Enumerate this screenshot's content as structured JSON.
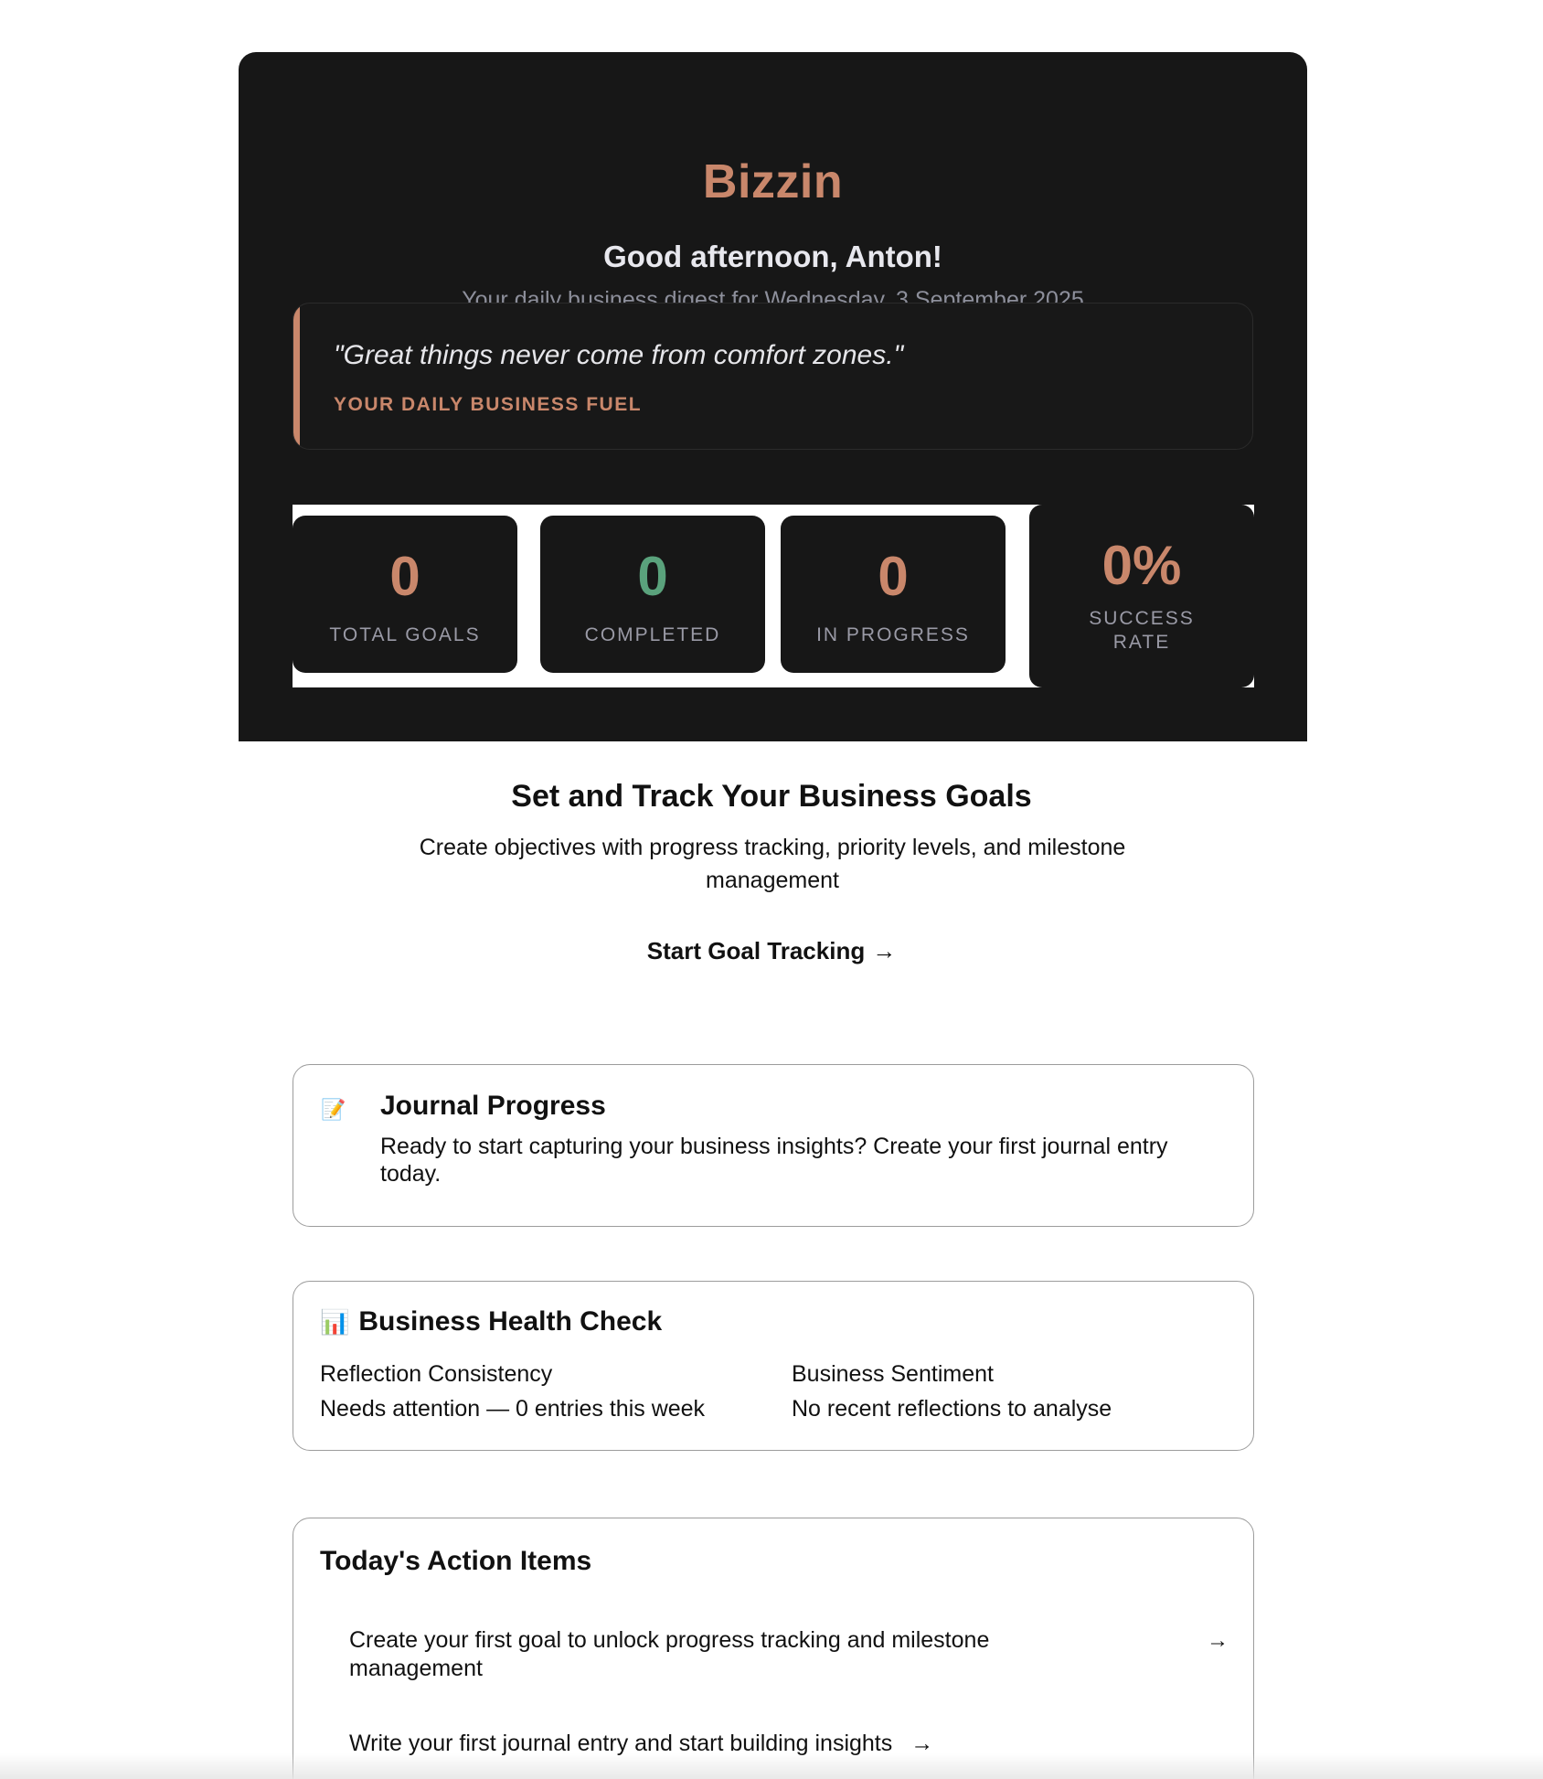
{
  "brand": "Bizzin",
  "greeting": "Good afternoon, Anton!",
  "digest": "Your daily business digest for Wednesday, 3 September 2025",
  "quote": {
    "text": "\"Great things never come from comfort zones.\"",
    "subtitle": "YOUR DAILY BUSINESS FUEL"
  },
  "stats": {
    "total_goals": {
      "value": "0",
      "label": "TOTAL GOALS"
    },
    "completed": {
      "value": "0",
      "label": "COMPLETED"
    },
    "in_progress": {
      "value": "0",
      "label": "IN PROGRESS"
    },
    "success_rate": {
      "value": "0%",
      "label_line1": "SUCCESS",
      "label_line2": "RATE"
    }
  },
  "goals_cta": {
    "title": "Set and Track Your Business Goals",
    "description": "Create objectives with progress tracking, priority levels, and milestone management",
    "link_label": "Start Goal Tracking",
    "link_arrow": "→"
  },
  "journal": {
    "icon": "📝",
    "title": "Journal Progress",
    "text": "Ready to start capturing your business insights? Create your first journal entry today."
  },
  "health": {
    "icon": "📊",
    "title": "Business Health Check",
    "reflection_label": "Reflection Consistency",
    "reflection_value": "Needs attention — 0 entries this week",
    "sentiment_label": "Business Sentiment",
    "sentiment_value": "No recent reflections to analyse"
  },
  "actions": {
    "title": "Today's Action Items",
    "items": [
      {
        "text": "Create your first goal to unlock progress tracking and milestone management",
        "arrow": "→"
      },
      {
        "text": "Write your first journal entry and start building insights",
        "arrow": "→"
      }
    ]
  },
  "colors": {
    "accent": "#c9876b",
    "success": "#5aa27c",
    "hero_background": "#171717"
  }
}
